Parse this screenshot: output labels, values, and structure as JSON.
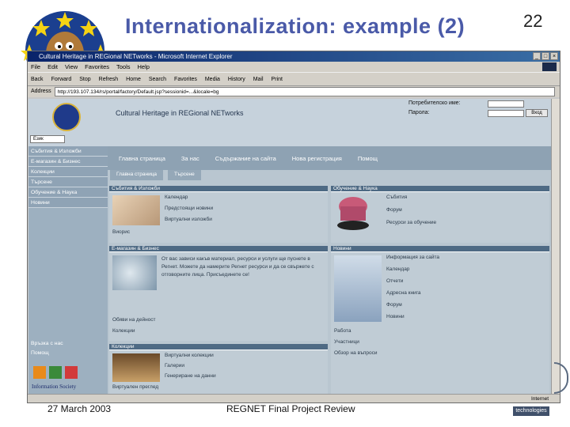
{
  "slide": {
    "title": "Internationalization: example (2)",
    "number": "22",
    "footer_date": "27 March 2003",
    "footer_review": "REGNET Final Project Review",
    "tech_logo_text": "technologies"
  },
  "browser": {
    "title": "Cultural Heritage in REGional NETworks - Microsoft Internet Explorer",
    "menu": [
      "File",
      "Edit",
      "View",
      "Favorites",
      "Tools",
      "Help"
    ],
    "toolbar": [
      "Back",
      "Forward",
      "Stop",
      "Refresh",
      "Home",
      "Search",
      "Favorites",
      "Media",
      "History",
      "Mail",
      "Print"
    ],
    "address_label": "Address",
    "address_value": "http://193.107.134/rs/portal/factory/Default.jsp?sessionid=...&locale=bg",
    "status_zone": "Internet"
  },
  "site": {
    "name": "Cultural Heritage in REGional NETworks",
    "username_label": "Потребителско име:",
    "password_label": "Парола:",
    "login_button": "Вход",
    "language_select": "Език",
    "topnav": [
      "Главна страница",
      "За нас",
      "Съдържание на сайта",
      "Нова регистрация",
      "Помощ"
    ],
    "subtabs": [
      "Главна страница",
      "Търсене"
    ],
    "leftnav": [
      "Събития & Изложби",
      "Е-магазин & Бизнес",
      "Колекции",
      "Търсене",
      "Обучение & Наука",
      "Новини"
    ],
    "leftnav_bottom": [
      "Връзка с нас",
      "Помощ"
    ],
    "panels": {
      "events": {
        "title": "Събития & Изложби",
        "links": [
          "Календар",
          "Предстоящи новини",
          "Виртуални изложби",
          "Виорис"
        ]
      },
      "education": {
        "title": "Обучение & Наука",
        "links": [
          "Събития",
          "Форум",
          "Ресурси за обучение"
        ]
      },
      "ebusiness": {
        "title": "Е-магазин & Бизнес",
        "text": "От вас зависи какъв материал, ресурси и услуги ще пуснете в Регнет. Можете да намерите Регнет ресурси и да се свържете с отговорните лица. Присъединете се!",
        "links": [
          "Обяви на дейност",
          "Колекции"
        ]
      },
      "news": {
        "title": "Новини",
        "links": [
          "Информация за сайта",
          "Календар",
          "Отчети",
          "Адресна книга",
          "Форум",
          "Новини",
          "Работа",
          "Участници",
          "Обзор на въпроси"
        ]
      },
      "collections": {
        "title": "Колекции",
        "links": [
          "Виртуални колекции",
          "Галерии",
          "Генериране на данни",
          "Виртуален преглед",
          "Архивни ресурси"
        ]
      }
    },
    "is_logo_text": "Information Society"
  },
  "colors": {
    "title_blue": "#4a5aa8",
    "nav_blue": "#8ea2b3",
    "panel_head": "#4e6a84"
  }
}
